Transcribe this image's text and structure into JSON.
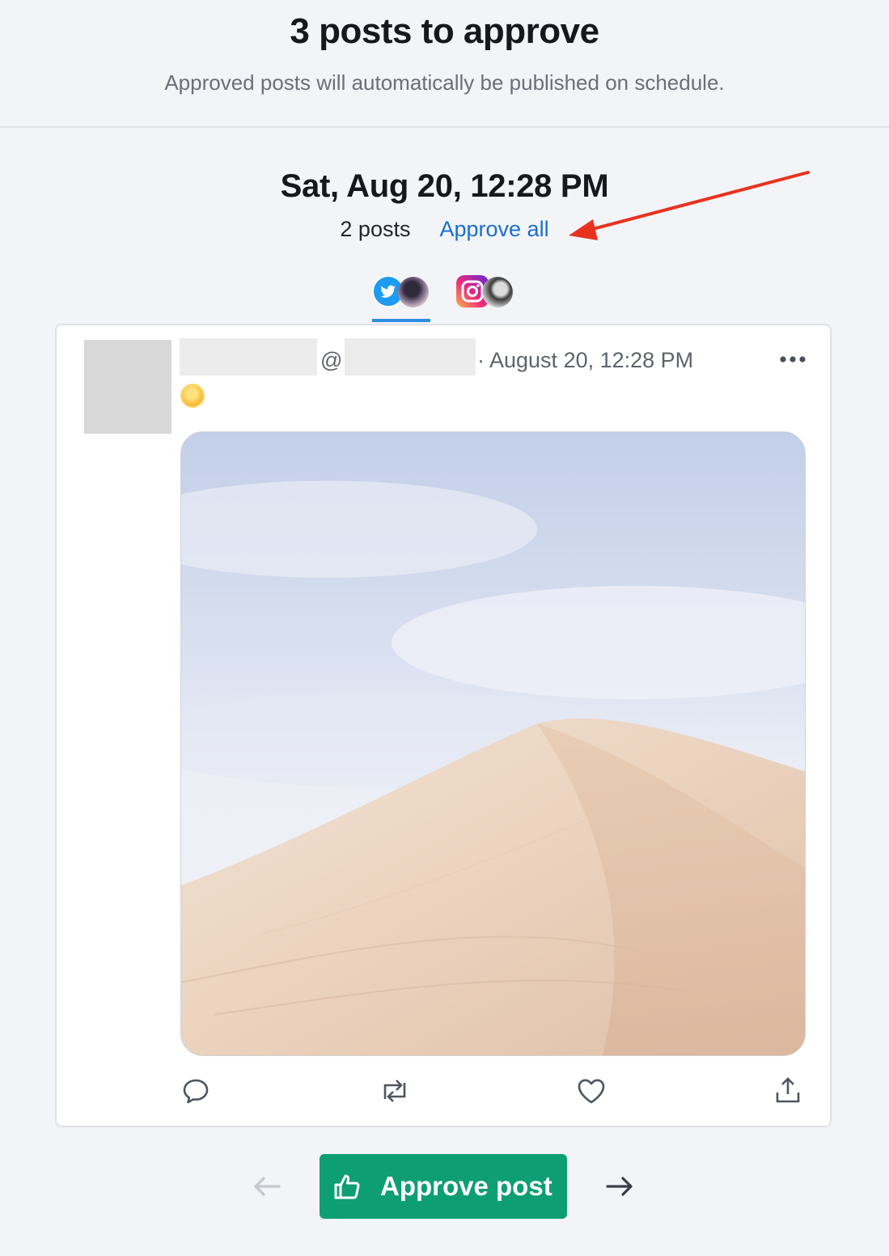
{
  "header": {
    "title": "3 posts to approve",
    "subtitle": "Approved posts will automatically be published on schedule."
  },
  "group": {
    "date_label": "Sat, Aug 20, 12:28 PM",
    "post_count": "2 posts",
    "approve_all_label": "Approve all"
  },
  "tabs": [
    {
      "network": "Twitter",
      "icon": "twitter-icon",
      "active": true
    },
    {
      "network": "Instagram",
      "icon": "instagram-icon",
      "active": false
    }
  ],
  "post": {
    "handle_prefix": "@",
    "date": "· August 20, 12:28 PM",
    "text_icon": "sun-emoji"
  },
  "footer": {
    "approve_label": "Approve post"
  },
  "colors": {
    "accent_link": "#1a6fd1",
    "approve_green": "#0e9e74",
    "tab_underline": "#2b8de3",
    "annotation_arrow": "#e8321e"
  }
}
